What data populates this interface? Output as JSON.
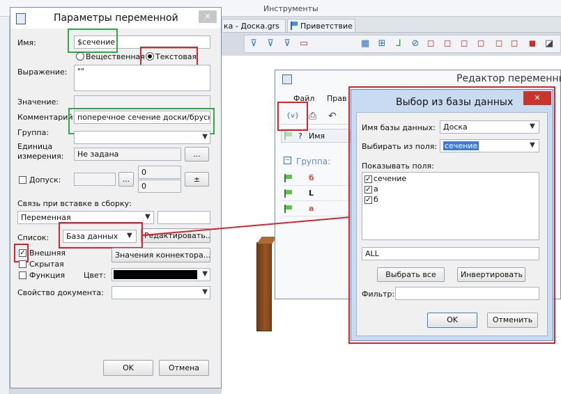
{
  "background_app": {
    "menu_group": "Инструменты",
    "tabs": [
      "ка - Доска.grs",
      "Приветствие"
    ],
    "editor_title": "Редактор переменных",
    "editor_menu": [
      "Файл",
      "Прав"
    ],
    "table_headers": [
      "?",
      "Имя"
    ],
    "group_label": "Группа:",
    "rows": [
      "б",
      "L",
      "a"
    ]
  },
  "var_dialog": {
    "title": "Параметры переменной",
    "close": "✕",
    "name_label": "Имя:",
    "name_value": "$сечение",
    "radio_real": "Вещественная",
    "radio_text": "Текстовая",
    "expr_label": "Выражение:",
    "expr_value": "\"\"",
    "value_label": "Значение:",
    "comment_label": "Комментарий:",
    "comment_value": "поперечное сечение доски/бруска",
    "group_label": "Группа:",
    "unit_label_1": "Единица",
    "unit_label_2": "измерения:",
    "unit_value": "Не задана",
    "unit_btn": "...",
    "tol_label": "Допуск:",
    "tol_btn": "...",
    "tol_val1": "0",
    "tol_val2": "0",
    "tol_pm": "±",
    "link_label": "Связь при вставке в сборку:",
    "link_value": "Переменная",
    "list_label": "Список:",
    "list_value": "База данных",
    "edit_btn": "Редактировать...",
    "ext_label": "Внешняя",
    "hidden_label": "Скрытая",
    "func_label": "Функция",
    "connector_btn": "Значения коннектора...",
    "color_label": "Цвет:",
    "docprop_label": "Свойство документа:",
    "ok": "OK",
    "cancel": "Отмена"
  },
  "db_dialog": {
    "title": "Выбор из базы данных",
    "close": "✕",
    "db_name_label": "Имя базы данных:",
    "db_name_value": "Доска",
    "field_label": "Выбирать из поля:",
    "field_value": "сечение",
    "show_label": "Показывать поля:",
    "show_fields": [
      "сечение",
      "а",
      "б"
    ],
    "all_value": "ALL",
    "select_all": "Выбрать все",
    "invert": "Инвертировать",
    "filter_label": "Фильтр:",
    "ok": "OK",
    "cancel": "Отменить"
  },
  "colors": {
    "highlight_red": "#d9242f",
    "highlight_green": "#2ea84a",
    "selection_blue": "#3d7bd8",
    "wood": "#8b4a1e"
  }
}
